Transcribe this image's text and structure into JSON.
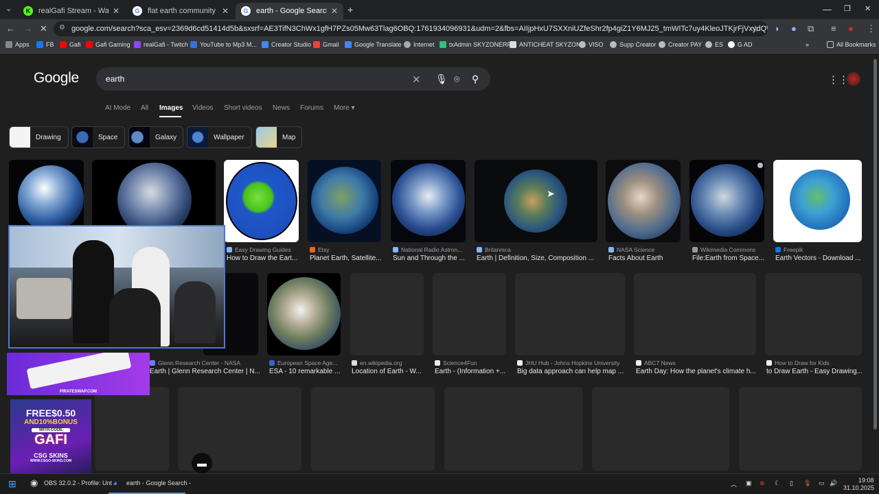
{
  "tabs": [
    {
      "title": "realGafi Stream - Watch Live on",
      "favicon": "K"
    },
    {
      "title": "flat earth community - Google",
      "favicon": "G"
    },
    {
      "title": "earth - Google Search",
      "favicon": "G"
    }
  ],
  "new_tab": "+",
  "window": {
    "minimize": "—",
    "maximize": "❐",
    "close": "✕"
  },
  "url": "google.com/search?sca_esv=2369d6cd51414d5b&sxsrf=AE3TifN3ChWx1gfH7PZs05Mw63Tlag6OBQ:1761934096931&udm=2&fbs=AIIjpHxU7SXXniUZfeShr2fp4giZ1Y6MJ25_tmWITc7uy4KleoJTKjrFjVxydQWqI2NcOhYPURIv2wPgv_w_sE_0S...",
  "bookmarks": [
    {
      "label": "Apps",
      "color": "#888"
    },
    {
      "label": "FB",
      "color": "#1877f2"
    },
    {
      "label": "Gafi",
      "color": "#ff0000"
    },
    {
      "label": "Gafi Gaming",
      "color": "#ff0000"
    },
    {
      "label": "realGafi - Twitch",
      "color": "#9146ff"
    },
    {
      "label": "YouTube to Mp3 M...",
      "color": "#3b6fd8"
    },
    {
      "label": "Creator Studio",
      "color": "#4285f4"
    },
    {
      "label": "Gmail",
      "color": "#ea4335"
    },
    {
      "label": "Google Translate",
      "color": "#4285f4"
    },
    {
      "label": "Internet",
      "color": "#aaa"
    },
    {
      "label": "txAdmin SKYZONERP",
      "color": "#2ec27e"
    },
    {
      "label": "ANTICHEAT SKYZONE",
      "color": "#ddd"
    },
    {
      "label": "VISO",
      "color": "#bbb"
    },
    {
      "label": "Supp Creator",
      "color": "#bbb"
    },
    {
      "label": "Creator PAY",
      "color": "#bbb"
    },
    {
      "label": "ES",
      "color": "#bbb"
    },
    {
      "label": "G AD",
      "color": "#fff"
    }
  ],
  "all_bookmarks": "All Bookmarks",
  "google": {
    "logo": "Google",
    "query": "earth",
    "nav": [
      "AI Mode",
      "All",
      "Images",
      "Videos",
      "Short videos",
      "News",
      "Forums",
      "More ▾"
    ],
    "chips": [
      "Drawing",
      "Space",
      "Galaxy",
      "Wallpaper",
      "Map"
    ]
  },
  "row1": [
    {
      "source": "Easy Drawing Guides",
      "caption": "How to Draw the Eart..."
    },
    {
      "source": "Etsy",
      "caption": "Planet Earth, Satellite..."
    },
    {
      "source": "National Radio Astron...",
      "caption": "Sun and Through the ..."
    },
    {
      "source": "Britannica",
      "caption": "Earth | Definition, Size, Composition ..."
    },
    {
      "source": "NASA Science",
      "caption": "Facts About Earth"
    },
    {
      "source": "Wikimedia Commons",
      "caption": "File:Earth from Space..."
    },
    {
      "source": "Freepik",
      "caption": "Earth Vectors - Download ..."
    }
  ],
  "row2": [
    {
      "source": "Glenn Research Center - NASA",
      "caption": "Earth | Glenn Research Center | N..."
    },
    {
      "source": "European Space Age...",
      "caption": "ESA - 10 remarkable ..."
    },
    {
      "source": "en.wikipedia.org",
      "caption": "Location of Earth - W..."
    },
    {
      "source": "Science4Fun",
      "caption": "Earth - (Information +..."
    },
    {
      "source": "JHU Hub - Johns Hopkins University",
      "caption": "Big data approach can help map ..."
    },
    {
      "source": "ABC7 News",
      "caption": "Earth Day: How the planet's climate h..."
    },
    {
      "source": "How to Draw for Kids",
      "caption": "to Draw Earth - Easy Drawing..."
    }
  ],
  "overlays": {
    "ad1_text": "PIRATESWAP.COM",
    "ad2_lines": [
      "FREE$0.50",
      "AND10%BONUS",
      "WITH CODE",
      "GAFI",
      "CSG SKINS",
      "WWW.CSGO-SKINS.COM"
    ]
  },
  "taskbar": {
    "obs": "OBS 32.0.2 - Profile: Unt",
    "chrome": "earth - Google Search -",
    "time": "19:08",
    "date": "31.10.2025"
  }
}
